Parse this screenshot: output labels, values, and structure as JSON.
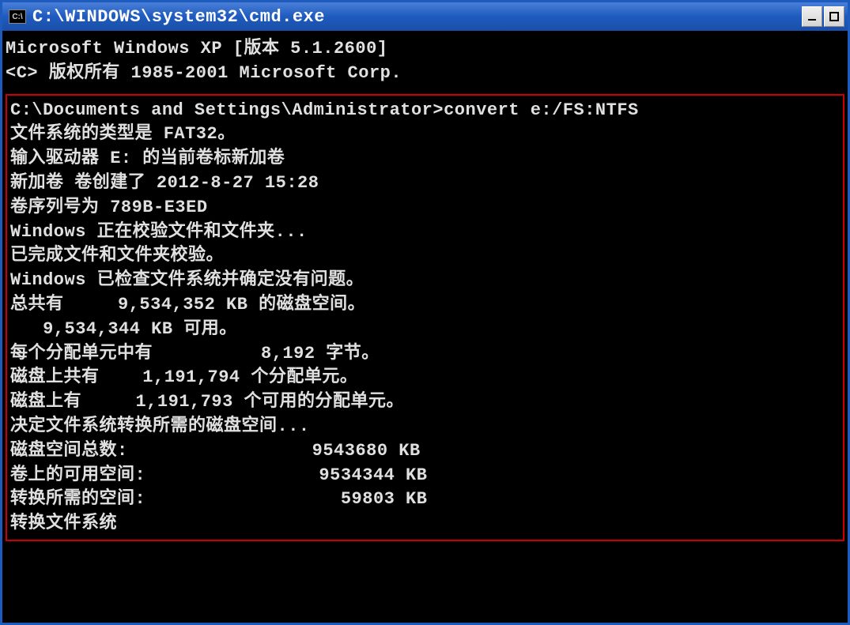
{
  "titlebar": {
    "icon_text": "C:\\",
    "title": "C:\\WINDOWS\\system32\\cmd.exe"
  },
  "terminal": {
    "header_line1": "Microsoft Windows XP [版本 5.1.2600]",
    "header_line2": "<C> 版权所有 1985-2001 Microsoft Corp.",
    "highlighted": {
      "line1": "C:\\Documents and Settings\\Administrator>convert e:/FS:NTFS",
      "line2": "文件系统的类型是 FAT32。",
      "line3": "输入驱动器 E: 的当前卷标新加卷",
      "line4": "新加卷 卷创建了 2012-8-27 15:28",
      "line5": "卷序列号为 789B-E3ED",
      "line6": "Windows 正在校验文件和文件夹...",
      "line7": "已完成文件和文件夹校验。",
      "line8": "Windows 已检查文件系统并确定没有问题。",
      "line9": "总共有     9,534,352 KB 的磁盘空间。",
      "line10": "   9,534,344 KB 可用。",
      "line11": "",
      "line12": "每个分配单元中有          8,192 字节。",
      "line13": "磁盘上共有    1,191,794 个分配单元。",
      "line14": "磁盘上有     1,191,793 个可用的分配单元。",
      "line15": "",
      "line16": "决定文件系统转换所需的磁盘空间...",
      "line17": "磁盘空间总数:                 9543680 KB",
      "line18": "卷上的可用空间:                9534344 KB",
      "line19": "转换所需的空间:                  59803 KB",
      "line20": "转换文件系统"
    }
  }
}
